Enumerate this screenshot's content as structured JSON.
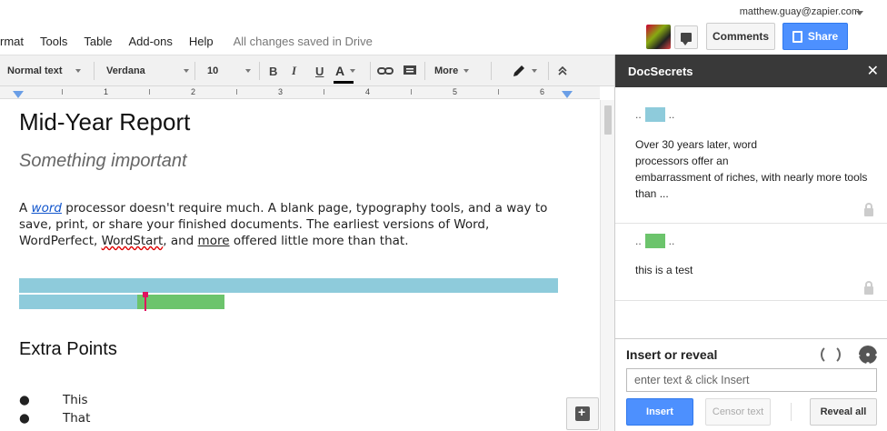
{
  "menu": {
    "items": [
      "rmat",
      "Tools",
      "Table",
      "Add-ons",
      "Help"
    ],
    "save_status": "All changes saved in Drive"
  },
  "account": {
    "email": "matthew.guay@zapier.com"
  },
  "header_buttons": {
    "comments": "Comments",
    "share": "Share"
  },
  "toolbar": {
    "style": "Normal text",
    "font": "Verdana",
    "size": "10",
    "bold": "B",
    "italic": "I",
    "underline": "U",
    "text_color": "A",
    "more": "More",
    "text_color_hex": "#000000"
  },
  "ruler": {
    "labels": [
      "1",
      "2",
      "3",
      "4",
      "5",
      "6"
    ]
  },
  "document": {
    "title": "Mid-Year Report",
    "subtitle": "Something important",
    "paragraph": {
      "prefix": "A ",
      "link": "word",
      "part1": " processor doesn't require much. A blank page, typography tools, and a way to save, print, or share your finished documents. The earliest versions of Word, WordPerfect, ",
      "squiggle": "WordStart",
      "part2": ", and ",
      "underlined": "more",
      "part3": " offered little more than that."
    },
    "heading2": "Extra Points",
    "bullets": [
      "This",
      "That"
    ],
    "bullet_char": "●",
    "bar_colors": {
      "blue": "#8ecbdb",
      "green": "#6cc46c",
      "cursor": "#e0115f"
    }
  },
  "panel": {
    "title": "DocSecrets",
    "close": "✕",
    "secrets": [
      {
        "marker_pre": "..",
        "marker_post": "..",
        "color": "#8ecbdb",
        "text": "Over 30 years later, word\nprocessors offer an\nembarrassment of riches, with nearly more tools than ..."
      },
      {
        "marker_pre": "..",
        "marker_post": "..",
        "color": "#6cc46c",
        "text": "this is a test"
      }
    ],
    "insert_title": "Insert or reveal",
    "input_placeholder": "enter text & click Insert",
    "btn_insert": "Insert",
    "btn_censor": "Censor text",
    "btn_reveal": "Reveal all"
  }
}
